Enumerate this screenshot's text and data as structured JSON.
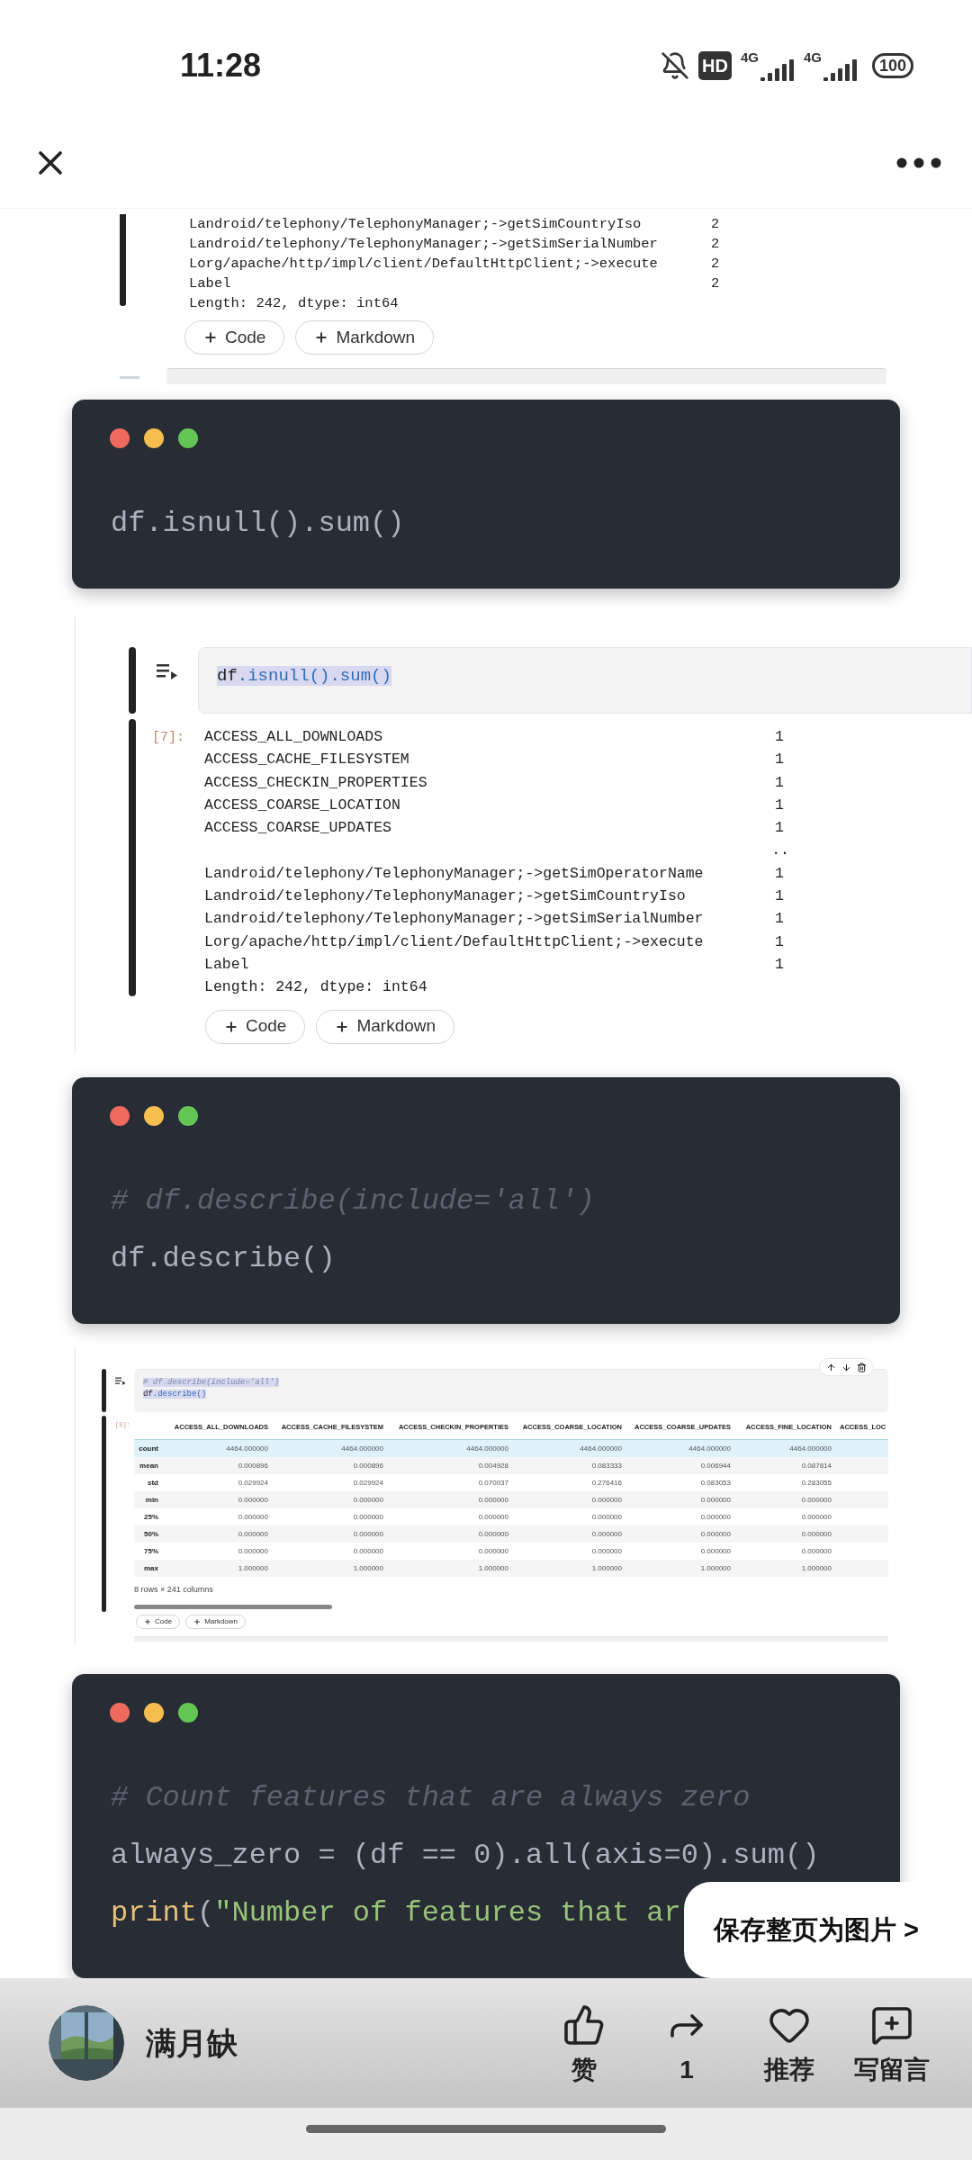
{
  "status_bar": {
    "time": "11:28",
    "hd_badge": "HD",
    "networks": [
      "4G",
      "4G"
    ],
    "battery": "100"
  },
  "blocks": [
    {
      "kind": "fragment",
      "lines": [
        {
          "name": "Landroid/telephony/TelephonyManager;->getSimCountryIso",
          "value": "2"
        },
        {
          "name": "Landroid/telephony/TelephonyManager;->getSimSerialNumber",
          "value": "2"
        },
        {
          "name": "Lorg/apache/http/impl/client/DefaultHttpClient;->execute",
          "value": "2"
        },
        {
          "name": "Label",
          "value": "2"
        }
      ],
      "footer": "Length: 242, dtype: int64",
      "buttons": [
        "Code",
        "Markdown"
      ]
    },
    {
      "kind": "code_card",
      "lines": [
        [
          {
            "kind": "plain",
            "text": "df.isnull().sum()"
          }
        ]
      ]
    },
    {
      "kind": "series_cell",
      "input": [
        {
          "highlighted": true,
          "tokens": [
            {
              "kind": "name",
              "text": "df"
            },
            {
              "kind": "attr",
              "text": ".isnull().sum()"
            }
          ]
        }
      ],
      "prompt": "[7]:",
      "lines": [
        {
          "name": "ACCESS_ALL_DOWNLOADS",
          "value": "1"
        },
        {
          "name": "ACCESS_CACHE_FILESYSTEM",
          "value": "1"
        },
        {
          "name": "ACCESS_CHECKIN_PROPERTIES",
          "value": "1"
        },
        {
          "name": "ACCESS_COARSE_LOCATION",
          "value": "1"
        },
        {
          "name": "ACCESS_COARSE_UPDATES",
          "value": "1"
        },
        {
          "value": ".."
        },
        {
          "name": "Landroid/telephony/TelephonyManager;->getSimOperatorName",
          "value": "1"
        },
        {
          "name": "Landroid/telephony/TelephonyManager;->getSimCountryIso",
          "value": "1"
        },
        {
          "name": "Landroid/telephony/TelephonyManager;->getSimSerialNumber",
          "value": "1"
        },
        {
          "name": "Lorg/apache/http/impl/client/DefaultHttpClient;->execute",
          "value": "1"
        },
        {
          "name": "Label",
          "value": "1"
        }
      ],
      "footer": "Length: 242, dtype: int64",
      "buttons": [
        "Code",
        "Markdown"
      ]
    },
    {
      "kind": "code_card",
      "lines": [
        [
          {
            "kind": "comment",
            "text": "# df.describe(include='all')"
          }
        ],
        [
          {
            "kind": "plain",
            "text": "df.describe()"
          }
        ]
      ]
    },
    {
      "kind": "table_cell",
      "input": [
        {
          "highlighted": true,
          "tokens": [
            {
              "kind": "comment",
              "text": "# df.describe(include='all')"
            }
          ]
        },
        {
          "highlighted": true,
          "tokens": [
            {
              "kind": "name",
              "text": "df"
            },
            {
              "kind": "attr",
              "text": ".describe()"
            }
          ]
        }
      ],
      "prompt": "[8]:",
      "columns": [
        "ACCESS_ALL_DOWNLOADS",
        "ACCESS_CACHE_FILESYSTEM",
        "ACCESS_CHECKIN_PROPERTIES",
        "ACCESS_COARSE_LOCATION",
        "ACCESS_COARSE_UPDATES",
        "ACCESS_FINE_LOCATION",
        "ACCESS_LOC"
      ],
      "rows": [
        {
          "label": "count",
          "selected": true,
          "values": [
            "4464.000000",
            "4464.000000",
            "4464.000000",
            "4464.000000",
            "4464.000000",
            "4464.000000"
          ]
        },
        {
          "label": "mean",
          "selected": false,
          "values": [
            "0.000896",
            "0.000896",
            "0.004928",
            "0.083333",
            "0.006944",
            "0.087814"
          ]
        },
        {
          "label": "std",
          "selected": false,
          "values": [
            "0.029924",
            "0.029924",
            "0.070037",
            "0.276416",
            "0.083053",
            "0.283055"
          ]
        },
        {
          "label": "min",
          "selected": false,
          "values": [
            "0.000000",
            "0.000000",
            "0.000000",
            "0.000000",
            "0.000000",
            "0.000000"
          ]
        },
        {
          "label": "25%",
          "selected": false,
          "values": [
            "0.000000",
            "0.000000",
            "0.000000",
            "0.000000",
            "0.000000",
            "0.000000"
          ]
        },
        {
          "label": "50%",
          "selected": false,
          "values": [
            "0.000000",
            "0.000000",
            "0.000000",
            "0.000000",
            "0.000000",
            "0.000000"
          ]
        },
        {
          "label": "75%",
          "selected": false,
          "values": [
            "0.000000",
            "0.000000",
            "0.000000",
            "0.000000",
            "0.000000",
            "0.000000"
          ]
        },
        {
          "label": "max",
          "selected": false,
          "values": [
            "1.000000",
            "1.000000",
            "1.000000",
            "1.000000",
            "1.000000",
            "1.000000"
          ]
        }
      ],
      "summary": "8 rows × 241 columns",
      "buttons": [
        "Code",
        "Markdown"
      ]
    },
    {
      "kind": "code_card",
      "lines": [
        [
          {
            "kind": "comment",
            "text": "# Count features that are always zero"
          }
        ],
        [
          {
            "kind": "plain",
            "text": "always_zero = (df == 0).all(axis=0).sum()"
          }
        ],
        [
          {
            "kind": "func",
            "text": "print"
          },
          {
            "kind": "plain",
            "text": "("
          },
          {
            "kind": "string",
            "text": "\"Number of features that ar"
          }
        ]
      ]
    }
  ],
  "save_popup": "保存整页为图片 >",
  "bottom_bar": {
    "author": "满月缺",
    "actions": [
      {
        "kind": "like",
        "label": "赞"
      },
      {
        "kind": "share",
        "label": "1"
      },
      {
        "kind": "heart",
        "label": "推荐"
      },
      {
        "kind": "comment",
        "label": "写留言"
      }
    ]
  }
}
